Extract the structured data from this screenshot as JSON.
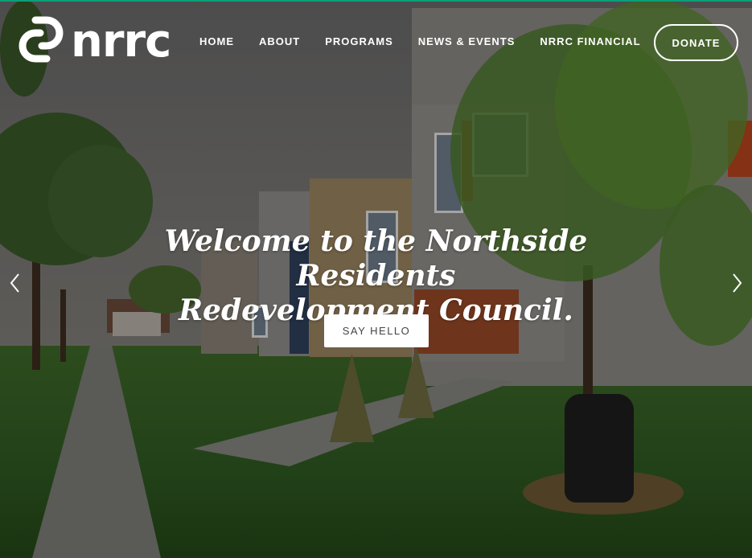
{
  "brand": {
    "logo_text": "nrrc",
    "logo_icon": "linked-chain-icon"
  },
  "nav": {
    "items": [
      {
        "label": "HOME"
      },
      {
        "label": "ABOUT"
      },
      {
        "label": "PROGRAMS"
      },
      {
        "label": "NEWS & EVENTS"
      },
      {
        "label": "NRRC FINANCIAL"
      }
    ],
    "donate_label": "DONATE"
  },
  "hero": {
    "headline_line1": "Welcome to the Northside Residents",
    "headline_line2": "Redevelopment Council.",
    "cta_label": "SAY HELLO",
    "prev_icon": "chevron-left-icon",
    "next_icon": "chevron-right-icon"
  },
  "colors": {
    "accent_line": "#0aa07a",
    "text": "#ffffff",
    "cta_text": "#444444"
  }
}
